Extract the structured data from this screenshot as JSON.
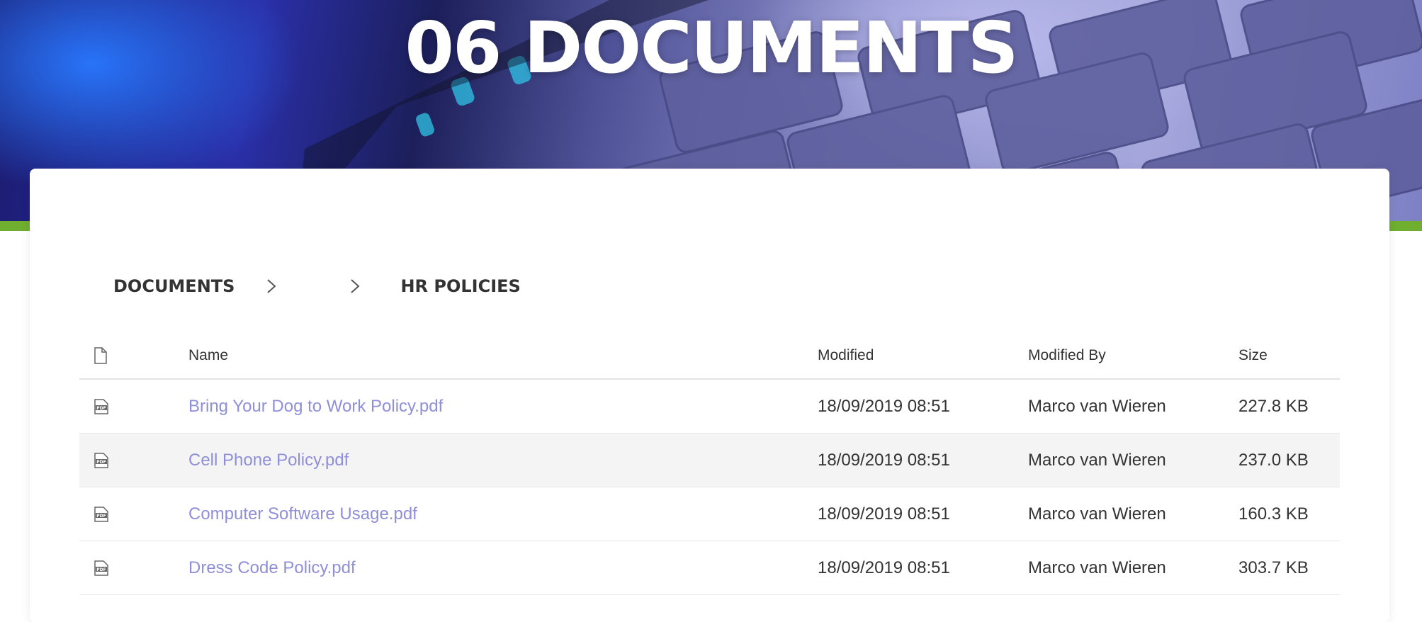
{
  "page": {
    "title": "06 DOCUMENTS"
  },
  "breadcrumb": {
    "items": [
      {
        "label": "DOCUMENTS"
      },
      {
        "label": ""
      },
      {
        "label": "HR POLICIES"
      }
    ]
  },
  "table": {
    "columns": {
      "icon": "file-icon",
      "name": "Name",
      "modified": "Modified",
      "modified_by": "Modified By",
      "size": "Size"
    },
    "rows": [
      {
        "icon": "pdf-icon",
        "name": "Bring Your Dog to Work Policy.pdf",
        "modified": "18/09/2019 08:51",
        "modified_by": "Marco van Wieren",
        "size": "227.8 KB"
      },
      {
        "icon": "pdf-icon",
        "name": "Cell Phone Policy.pdf",
        "modified": "18/09/2019 08:51",
        "modified_by": "Marco van Wieren",
        "size": "237.0 KB"
      },
      {
        "icon": "pdf-icon",
        "name": "Computer Software Usage.pdf",
        "modified": "18/09/2019 08:51",
        "modified_by": "Marco van Wieren",
        "size": "160.3 KB"
      },
      {
        "icon": "pdf-icon",
        "name": "Dress Code Policy.pdf",
        "modified": "18/09/2019 08:51",
        "modified_by": "Marco van Wieren",
        "size": "303.7 KB"
      }
    ]
  },
  "colors": {
    "accent_green": "#6fae2f",
    "link": "#8f8fd9",
    "row_alt": "#f4f4f4",
    "text": "#333333"
  }
}
